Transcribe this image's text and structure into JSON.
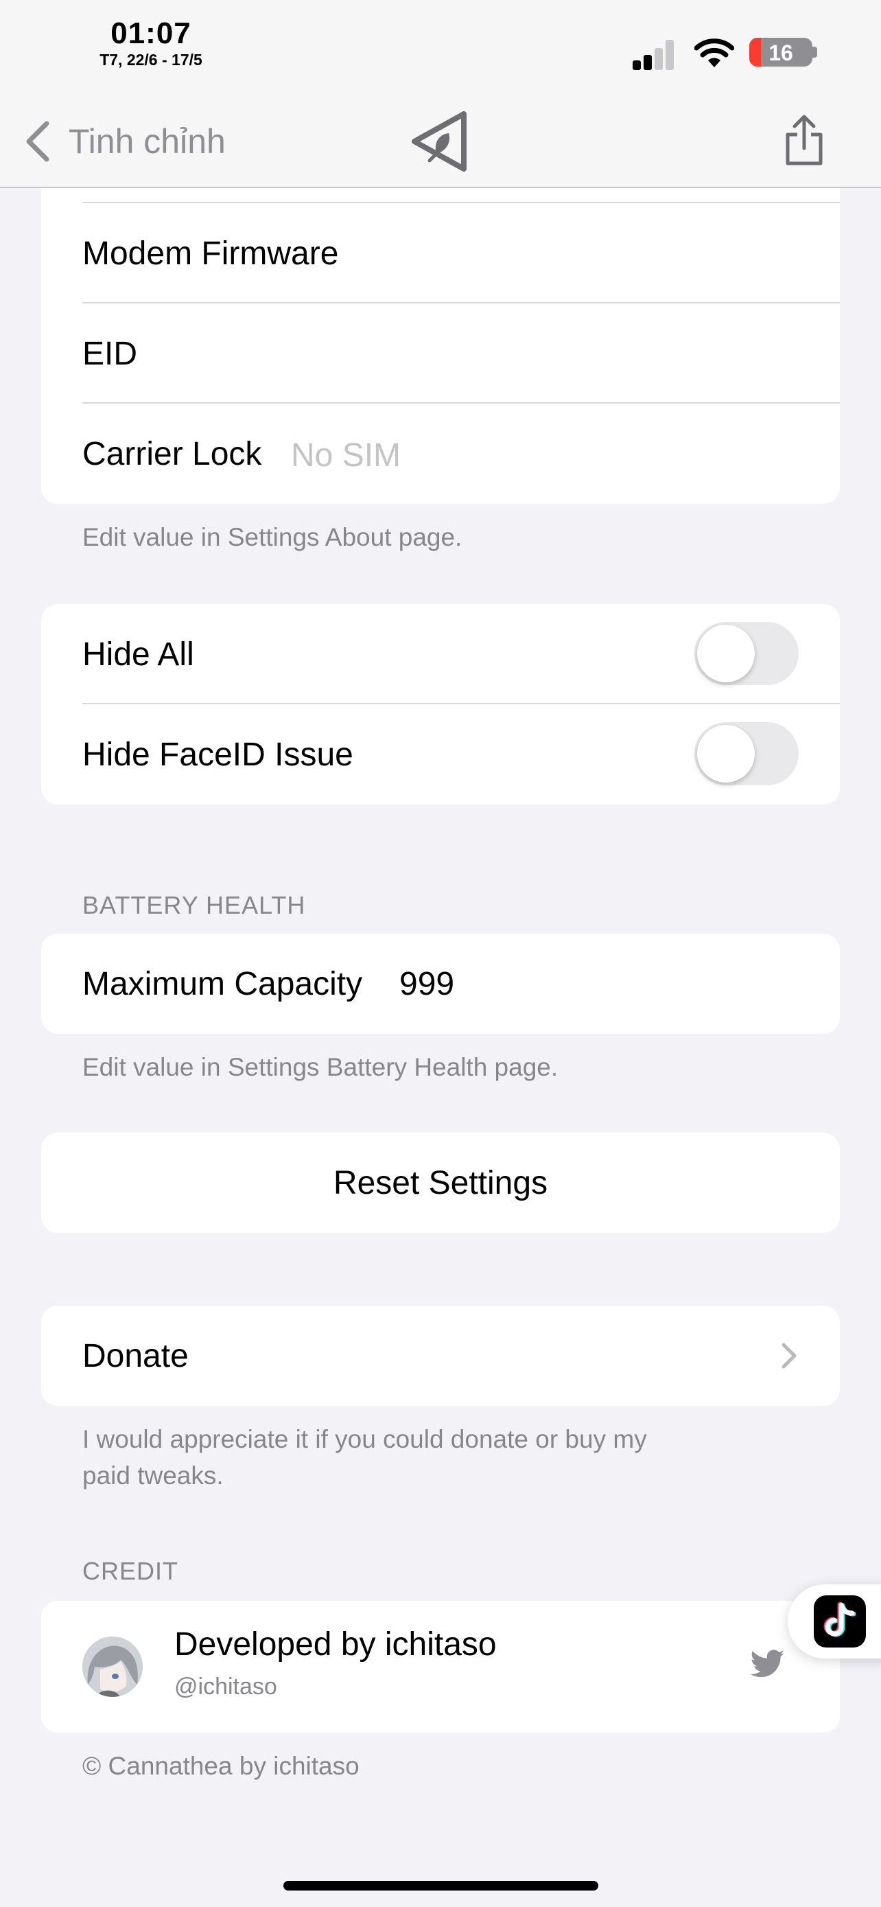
{
  "status_bar": {
    "time": "01:07",
    "date": "T7, 22/6 - 17/5",
    "battery_percent": "16",
    "battery_level": 0.16,
    "signal_bars_active": 2,
    "icons": [
      "signal-icon",
      "wifi-icon",
      "battery-icon"
    ]
  },
  "nav": {
    "back_label": "Tinh chỉnh",
    "logo_icon": "cannathea-logo-icon",
    "share_icon": "share-icon"
  },
  "device_info": {
    "rows": [
      {
        "label": "Modem Firmware",
        "value": ""
      },
      {
        "label": "EID",
        "value": ""
      },
      {
        "label": "Carrier Lock",
        "value": "No SIM"
      }
    ],
    "footer": "Edit value in Settings About page."
  },
  "toggles": [
    {
      "label": "Hide All",
      "on": false
    },
    {
      "label": "Hide FaceID Issue",
      "on": false
    }
  ],
  "battery_health": {
    "header": "BATTERY HEALTH",
    "label": "Maximum Capacity",
    "value": "999",
    "footer": "Edit value in Settings Battery Health page."
  },
  "reset": {
    "label": "Reset Settings"
  },
  "donate": {
    "label": "Donate",
    "footer_line1": "I would appreciate it if you could donate or buy my",
    "footer_line2": "paid tweaks."
  },
  "credit": {
    "header": "CREDIT",
    "title": "Developed by ichitaso",
    "handle": "@ichitaso",
    "footer": "© Cannathea by ichitaso"
  },
  "colors": {
    "background": "#f2f2f7",
    "card": "#ffffff",
    "secondary_text": "#86868b",
    "placeholder": "#c4c4c6",
    "toggle_off": "#e9e9eb",
    "battery_low": "#ff3b30"
  }
}
